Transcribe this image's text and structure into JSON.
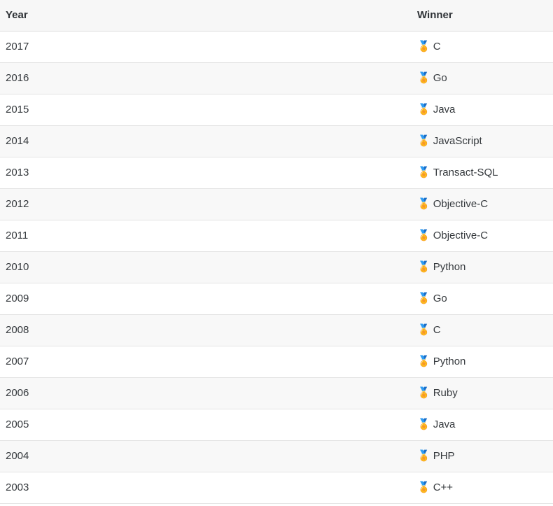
{
  "table": {
    "columns": [
      {
        "key": "year",
        "label": "Year"
      },
      {
        "key": "winner",
        "label": "Winner"
      }
    ],
    "medal_icon": "sports-medal-icon",
    "medal_glyph": "🏅",
    "colors": {
      "header_background": "#f7f7f7",
      "header_text": "#2f3337",
      "row_odd_background": "#ffffff",
      "row_even_background": "#f8f8f8",
      "row_border": "#e4e4e4",
      "header_border": "#dddddd",
      "body_text": "#35393d"
    },
    "rows": [
      {
        "year": "2017",
        "winner": "C"
      },
      {
        "year": "2016",
        "winner": "Go"
      },
      {
        "year": "2015",
        "winner": "Java"
      },
      {
        "year": "2014",
        "winner": "JavaScript"
      },
      {
        "year": "2013",
        "winner": "Transact-SQL"
      },
      {
        "year": "2012",
        "winner": "Objective-C"
      },
      {
        "year": "2011",
        "winner": "Objective-C"
      },
      {
        "year": "2010",
        "winner": "Python"
      },
      {
        "year": "2009",
        "winner": "Go"
      },
      {
        "year": "2008",
        "winner": "C"
      },
      {
        "year": "2007",
        "winner": "Python"
      },
      {
        "year": "2006",
        "winner": "Ruby"
      },
      {
        "year": "2005",
        "winner": "Java"
      },
      {
        "year": "2004",
        "winner": "PHP"
      },
      {
        "year": "2003",
        "winner": "C++"
      }
    ]
  }
}
